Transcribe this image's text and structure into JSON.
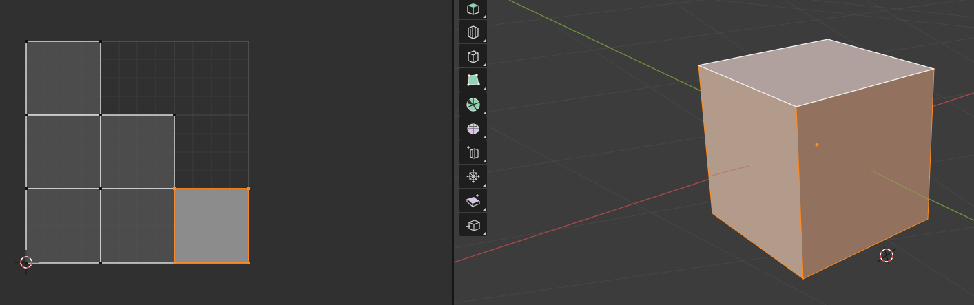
{
  "uv_editor": {
    "grid": {
      "columns": 3,
      "rows": 3
    },
    "faces": [
      {
        "col": 0,
        "row": 0,
        "selected": false
      },
      {
        "col": 0,
        "row": 1,
        "selected": false
      },
      {
        "col": 1,
        "row": 1,
        "selected": false
      },
      {
        "col": 0,
        "row": 2,
        "selected": false
      },
      {
        "col": 1,
        "row": 2,
        "selected": false
      },
      {
        "col": 2,
        "row": 2,
        "selected": true
      }
    ]
  },
  "viewport": {
    "toolbar": [
      {
        "name": "extrude-region-icon",
        "accent": "#8fd3b0"
      },
      {
        "name": "inset-faces-icon",
        "accent": "#d0d0d0"
      },
      {
        "name": "bevel-icon",
        "accent": "#d0d0d0"
      },
      {
        "name": "loop-cut-icon",
        "accent": "#8fd3b0"
      },
      {
        "name": "knife-icon",
        "accent": "#8fd3b0"
      },
      {
        "name": "poly-build-icon",
        "accent": "#d9c5e8"
      },
      {
        "name": "spin-icon",
        "accent": "#d0d0d0"
      },
      {
        "name": "smooth-icon",
        "accent": "#d0d0d0"
      },
      {
        "name": "edge-slide-icon",
        "accent": "#d9c5e8"
      },
      {
        "name": "shrink-fatten-icon",
        "accent": "#d0d0d0"
      }
    ]
  },
  "colors": {
    "selection_orange": "#ff8a1e",
    "uv_edge": "#e6e6e6",
    "uv_face": "#585858",
    "uv_face_selected": "#8c8c8c",
    "cube_top": "#b0a19e",
    "cube_left": "#b39b8b",
    "cube_right": "#92715f",
    "x_axis": "#a84848",
    "y_axis": "#6e8f3a"
  }
}
